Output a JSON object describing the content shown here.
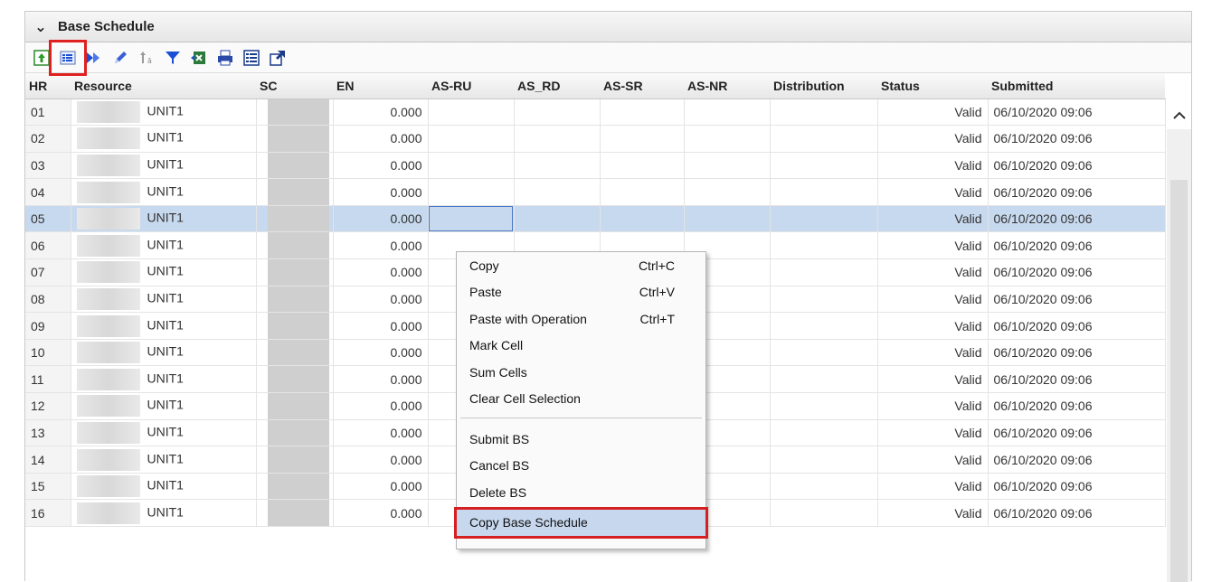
{
  "panel": {
    "title": "Base Schedule"
  },
  "toolbar": [
    {
      "name": "upload-icon"
    },
    {
      "name": "list-view-icon"
    },
    {
      "name": "fast-forward-icon"
    },
    {
      "name": "pencil-icon"
    },
    {
      "name": "sort-icon"
    },
    {
      "name": "filter-icon"
    },
    {
      "name": "export-excel-icon"
    },
    {
      "name": "print-icon"
    },
    {
      "name": "details-icon"
    },
    {
      "name": "popout-icon"
    }
  ],
  "columns": [
    "HR",
    "Resource",
    "SC",
    "EN",
    "AS-RU",
    "AS_RD",
    "AS-SR",
    "AS-NR",
    "Distribution",
    "Status",
    "Submitted"
  ],
  "rows": [
    {
      "hr": "01",
      "resource": "UNIT1",
      "en": "0.000",
      "status": "Valid",
      "submitted": "06/10/2020 09:06"
    },
    {
      "hr": "02",
      "resource": "UNIT1",
      "en": "0.000",
      "status": "Valid",
      "submitted": "06/10/2020 09:06"
    },
    {
      "hr": "03",
      "resource": "UNIT1",
      "en": "0.000",
      "status": "Valid",
      "submitted": "06/10/2020 09:06"
    },
    {
      "hr": "04",
      "resource": "UNIT1",
      "en": "0.000",
      "status": "Valid",
      "submitted": "06/10/2020 09:06"
    },
    {
      "hr": "05",
      "resource": "UNIT1",
      "en": "0.000",
      "status": "Valid",
      "submitted": "06/10/2020 09:06"
    },
    {
      "hr": "06",
      "resource": "UNIT1",
      "en": "0.000",
      "status": "Valid",
      "submitted": "06/10/2020 09:06"
    },
    {
      "hr": "07",
      "resource": "UNIT1",
      "en": "0.000",
      "status": "Valid",
      "submitted": "06/10/2020 09:06"
    },
    {
      "hr": "08",
      "resource": "UNIT1",
      "en": "0.000",
      "status": "Valid",
      "submitted": "06/10/2020 09:06"
    },
    {
      "hr": "09",
      "resource": "UNIT1",
      "en": "0.000",
      "status": "Valid",
      "submitted": "06/10/2020 09:06"
    },
    {
      "hr": "10",
      "resource": "UNIT1",
      "en": "0.000",
      "status": "Valid",
      "submitted": "06/10/2020 09:06"
    },
    {
      "hr": "11",
      "resource": "UNIT1",
      "en": "0.000",
      "status": "Valid",
      "submitted": "06/10/2020 09:06"
    },
    {
      "hr": "12",
      "resource": "UNIT1",
      "en": "0.000",
      "status": "Valid",
      "submitted": "06/10/2020 09:06"
    },
    {
      "hr": "13",
      "resource": "UNIT1",
      "en": "0.000",
      "status": "Valid",
      "submitted": "06/10/2020 09:06"
    },
    {
      "hr": "14",
      "resource": "UNIT1",
      "en": "0.000",
      "status": "Valid",
      "submitted": "06/10/2020 09:06"
    },
    {
      "hr": "15",
      "resource": "UNIT1",
      "en": "0.000",
      "status": "Valid",
      "submitted": "06/10/2020 09:06"
    },
    {
      "hr": "16",
      "resource": "UNIT1",
      "en": "0.000",
      "status": "Valid",
      "submitted": "06/10/2020 09:06"
    }
  ],
  "selected_row": "05",
  "context_menu": {
    "groups": [
      [
        {
          "label": "Copy",
          "shortcut": "Ctrl+C"
        },
        {
          "label": "Paste",
          "shortcut": "Ctrl+V"
        },
        {
          "label": "Paste with Operation",
          "shortcut": "Ctrl+T"
        },
        {
          "label": "Mark Cell",
          "shortcut": ""
        },
        {
          "label": "Sum Cells",
          "shortcut": ""
        },
        {
          "label": "Clear Cell Selection",
          "shortcut": ""
        }
      ],
      [
        {
          "label": "Submit BS",
          "shortcut": ""
        },
        {
          "label": "Cancel BS",
          "shortcut": ""
        },
        {
          "label": "Delete BS",
          "shortcut": ""
        },
        {
          "label": "Copy Base Schedule",
          "shortcut": "",
          "active": true
        }
      ]
    ]
  },
  "colors": {
    "selected_row": "#c7d9ee",
    "highlight_box": "#e02020",
    "toolbar_blue": "#1a4fd6"
  }
}
